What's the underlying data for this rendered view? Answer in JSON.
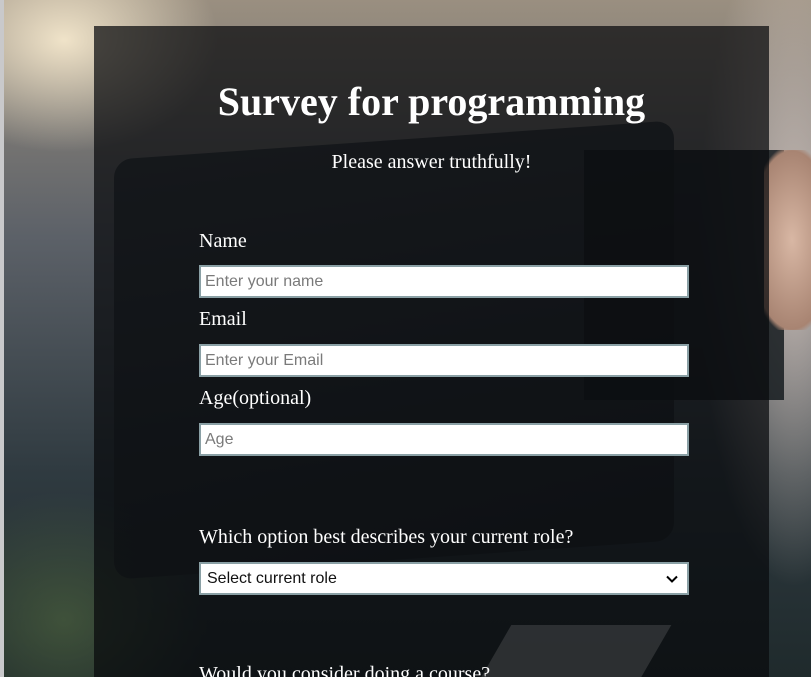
{
  "header": {
    "title": "Survey for programming",
    "subtitle": "Please answer truthfully!"
  },
  "form": {
    "name": {
      "label": "Name",
      "placeholder": "Enter your name"
    },
    "email": {
      "label": "Email",
      "placeholder": "Enter your Email"
    },
    "age": {
      "label": "Age(optional)",
      "placeholder": "Age"
    },
    "role": {
      "label": "Which option best describes your current role?",
      "selected": "Select current role"
    },
    "course": {
      "label": "Would you consider doing a course?"
    }
  },
  "icons": {
    "select_arrow": "chevron-down-icon"
  },
  "colors": {
    "overlay": "#0a0c0e",
    "text": "#ffffff",
    "field_border": "#8aa0a5"
  }
}
